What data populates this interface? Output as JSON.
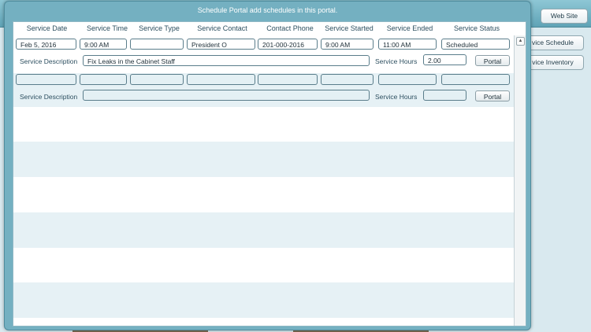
{
  "background": {
    "buttons": {
      "web_site": "Web Site",
      "service_schedule": "vice Schedule",
      "service_inventory": "vice Inventory"
    }
  },
  "modal": {
    "title": "Schedule Portal add schedules in this portal."
  },
  "columns": {
    "service_date": "Service Date",
    "service_time": "Service Time",
    "service_type": "Service Type",
    "service_contact": "Service Contact",
    "contact_phone": "Contact Phone",
    "service_started": "Service Started",
    "service_ended": "Service Ended",
    "service_status": "Service Status"
  },
  "labels": {
    "service_description": "Service Description",
    "service_hours": "Service Hours",
    "portal_button": "Portal"
  },
  "records": [
    {
      "service_date": "Feb 5, 2016",
      "service_time": "9:00 AM",
      "service_type": "",
      "service_contact": "President O",
      "contact_phone": "201-000-2016",
      "service_started": "9:00 AM",
      "service_ended": "11:00 AM",
      "service_status": "Scheduled",
      "service_description": "Fix Leaks in the Cabinet Staff",
      "service_hours": "2.00"
    },
    {
      "service_date": "",
      "service_time": "",
      "service_type": "",
      "service_contact": "",
      "contact_phone": "",
      "service_started": "",
      "service_ended": "",
      "service_status": "",
      "service_description": "",
      "service_hours": ""
    }
  ],
  "scrollbar": {
    "up_arrow": "▲"
  }
}
